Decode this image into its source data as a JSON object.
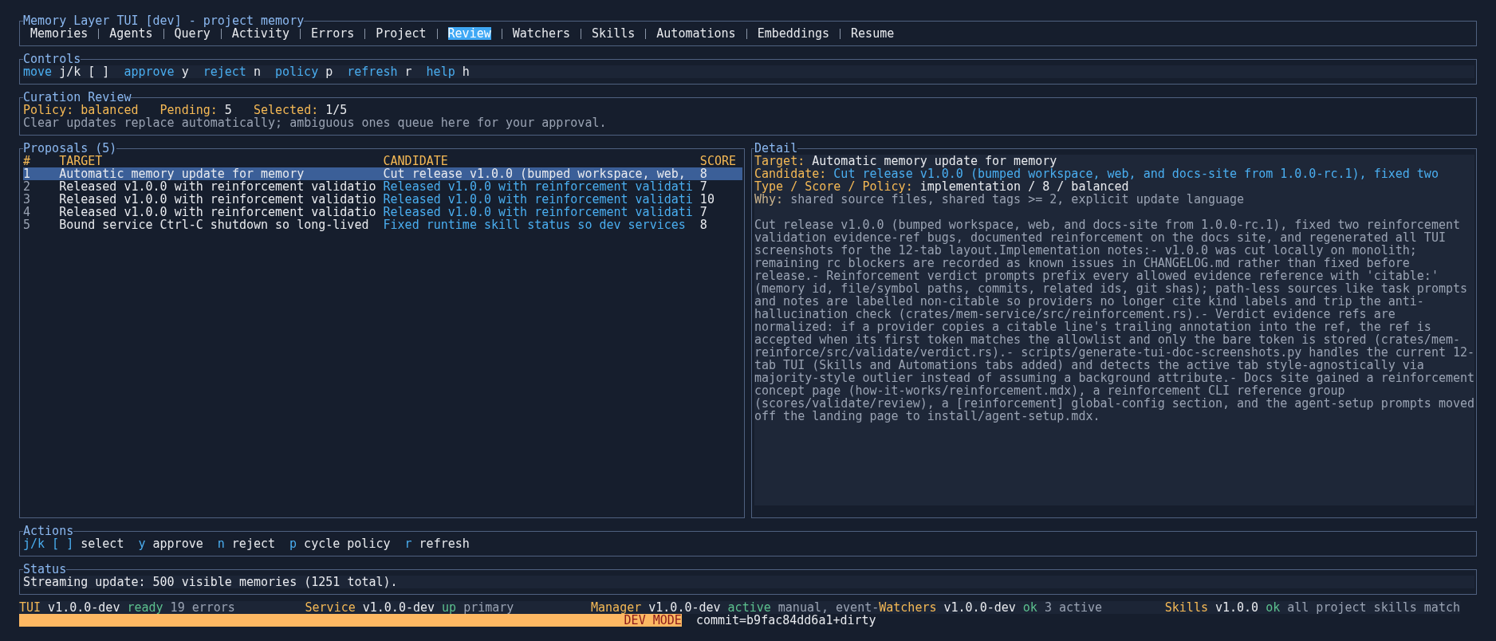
{
  "header": {
    "title": "Memory Layer TUI [dev] - project memory",
    "tabs": [
      {
        "label": "Memories",
        "selected": false
      },
      {
        "label": "Agents",
        "selected": false
      },
      {
        "label": "Query",
        "selected": false
      },
      {
        "label": "Activity",
        "selected": false
      },
      {
        "label": "Errors",
        "selected": false
      },
      {
        "label": "Project",
        "selected": false
      },
      {
        "label": "Review",
        "selected": true
      },
      {
        "label": "Watchers",
        "selected": false
      },
      {
        "label": "Skills",
        "selected": false
      },
      {
        "label": "Automations",
        "selected": false
      },
      {
        "label": "Embeddings",
        "selected": false
      },
      {
        "label": "Resume",
        "selected": false
      }
    ]
  },
  "controls": {
    "title": "Controls",
    "items": [
      {
        "action": "move",
        "key": "j/k [ ]"
      },
      {
        "action": "approve",
        "key": "y"
      },
      {
        "action": "reject",
        "key": "n"
      },
      {
        "action": "policy",
        "key": "p"
      },
      {
        "action": "refresh",
        "key": "r"
      },
      {
        "action": "help",
        "key": "h"
      }
    ]
  },
  "curation": {
    "title": "Curation Review",
    "stats": [
      {
        "label": "Policy:",
        "value": "balanced",
        "highlight": true
      },
      {
        "label": "Pending:",
        "value": "5",
        "highlight": false
      },
      {
        "label": "Selected:",
        "value": "1/5",
        "highlight": false
      }
    ],
    "note": "Clear updates replace automatically; ambiguous ones queue here for your approval."
  },
  "proposals": {
    "title": "Proposals (5)",
    "columns": [
      "#",
      "TARGET",
      "CANDIDATE",
      "SCORE"
    ],
    "rows": [
      {
        "index": "1",
        "target": "Automatic memory update for memory",
        "candidate": "Cut release v1.0.0 (bumped workspace, web,",
        "score": "8",
        "selected": true
      },
      {
        "index": "2",
        "target": "Released v1.0.0 with reinforcement validatio",
        "candidate": "Released v1.0.0 with reinforcement validati",
        "score": "7",
        "selected": false
      },
      {
        "index": "3",
        "target": "Released v1.0.0 with reinforcement validatio",
        "candidate": "Released v1.0.0 with reinforcement validati",
        "score": "10",
        "selected": false
      },
      {
        "index": "4",
        "target": "Released v1.0.0 with reinforcement validatio",
        "candidate": "Released v1.0.0 with reinforcement validati",
        "score": "7",
        "selected": false
      },
      {
        "index": "5",
        "target": "Bound service Ctrl-C shutdown so long-lived",
        "candidate": "Fixed runtime skill status so dev services",
        "score": "8",
        "selected": false
      }
    ]
  },
  "detail": {
    "title": "Detail",
    "fields": [
      {
        "label": "Target:",
        "value": "Automatic memory update for memory",
        "kind": "plain"
      },
      {
        "label": "Candidate:",
        "value": "Cut release v1.0.0 (bumped workspace, web, and docs-site from 1.0.0-rc.1), fixed two",
        "kind": "link"
      },
      {
        "label": "Type / Score / Policy:",
        "value": "implementation / 8 / balanced",
        "kind": "plain"
      },
      {
        "label": "Why:",
        "value": "shared source files, shared tags >= 2, explicit update language",
        "kind": "muted"
      }
    ],
    "body": "Cut release v1.0.0 (bumped workspace, web, and docs-site from 1.0.0-rc.1), fixed two reinforcement validation evidence-ref bugs, documented reinforcement on the docs site, and regenerated all TUI screenshots for the 12-tab layout.Implementation notes:- v1.0.0 was cut locally on monolith; remaining rc blockers are recorded as known issues in CHANGELOG.md rather than fixed before release.- Reinforcement verdict prompts prefix every allowed evidence reference with 'citable:' (memory id, file/symbol paths, commits, related ids, git shas); path-less sources like task prompts and notes are labelled non-citable so providers no longer cite kind labels and trip the anti-hallucination check (crates/mem-service/src/reinforcement.rs).- Verdict evidence refs are normalized: if a provider copies a citable line's trailing annotation into the ref, the ref is accepted when its first token matches the allowlist and only the bare token is stored (crates/mem-reinforce/src/validate/verdict.rs).- scripts/generate-tui-doc-screenshots.py handles the current 12-tab TUI (Skills and Automations tabs added) and detects the active tab style-agnostically via majority-style outlier instead of assuming a background attribute.- Docs site gained a reinforcement concept page (how-it-works/reinforcement.mdx), a reinforcement CLI reference group (scores/validate/review), a [reinforcement] global-config section, and the agent-setup prompts moved off the landing page to install/agent-setup.mdx."
  },
  "actions": {
    "title": "Actions",
    "items": [
      {
        "key": "j/k [ ]",
        "action": "select"
      },
      {
        "key": "y",
        "action": "approve"
      },
      {
        "key": "n",
        "action": "reject"
      },
      {
        "key": "p",
        "action": "cycle policy"
      },
      {
        "key": "r",
        "action": "refresh"
      }
    ]
  },
  "status": {
    "title": "Status",
    "message": "Streaming update: 500 visible memories (1251 total)."
  },
  "status_bar": [
    {
      "label": "TUI",
      "version": "v1.0.0-dev",
      "state": "ready",
      "note": "19 errors"
    },
    {
      "label": "Service",
      "version": "v1.0.0-dev",
      "state": "up",
      "note": "primary"
    },
    {
      "label": "Manager",
      "version": "v1.0.0-dev",
      "state": "active",
      "note": "manual, event-"
    },
    {
      "label": "Watchers",
      "version": "v1.0.0-dev",
      "state": "ok",
      "note": "3 active"
    },
    {
      "label": "Skills",
      "version": "v1.0.0",
      "state": "ok",
      "note": "all project skills match"
    }
  ],
  "dev_banner": {
    "label": "DEV MODE",
    "commit": "commit=b9fac84dd6a1+dirty"
  }
}
